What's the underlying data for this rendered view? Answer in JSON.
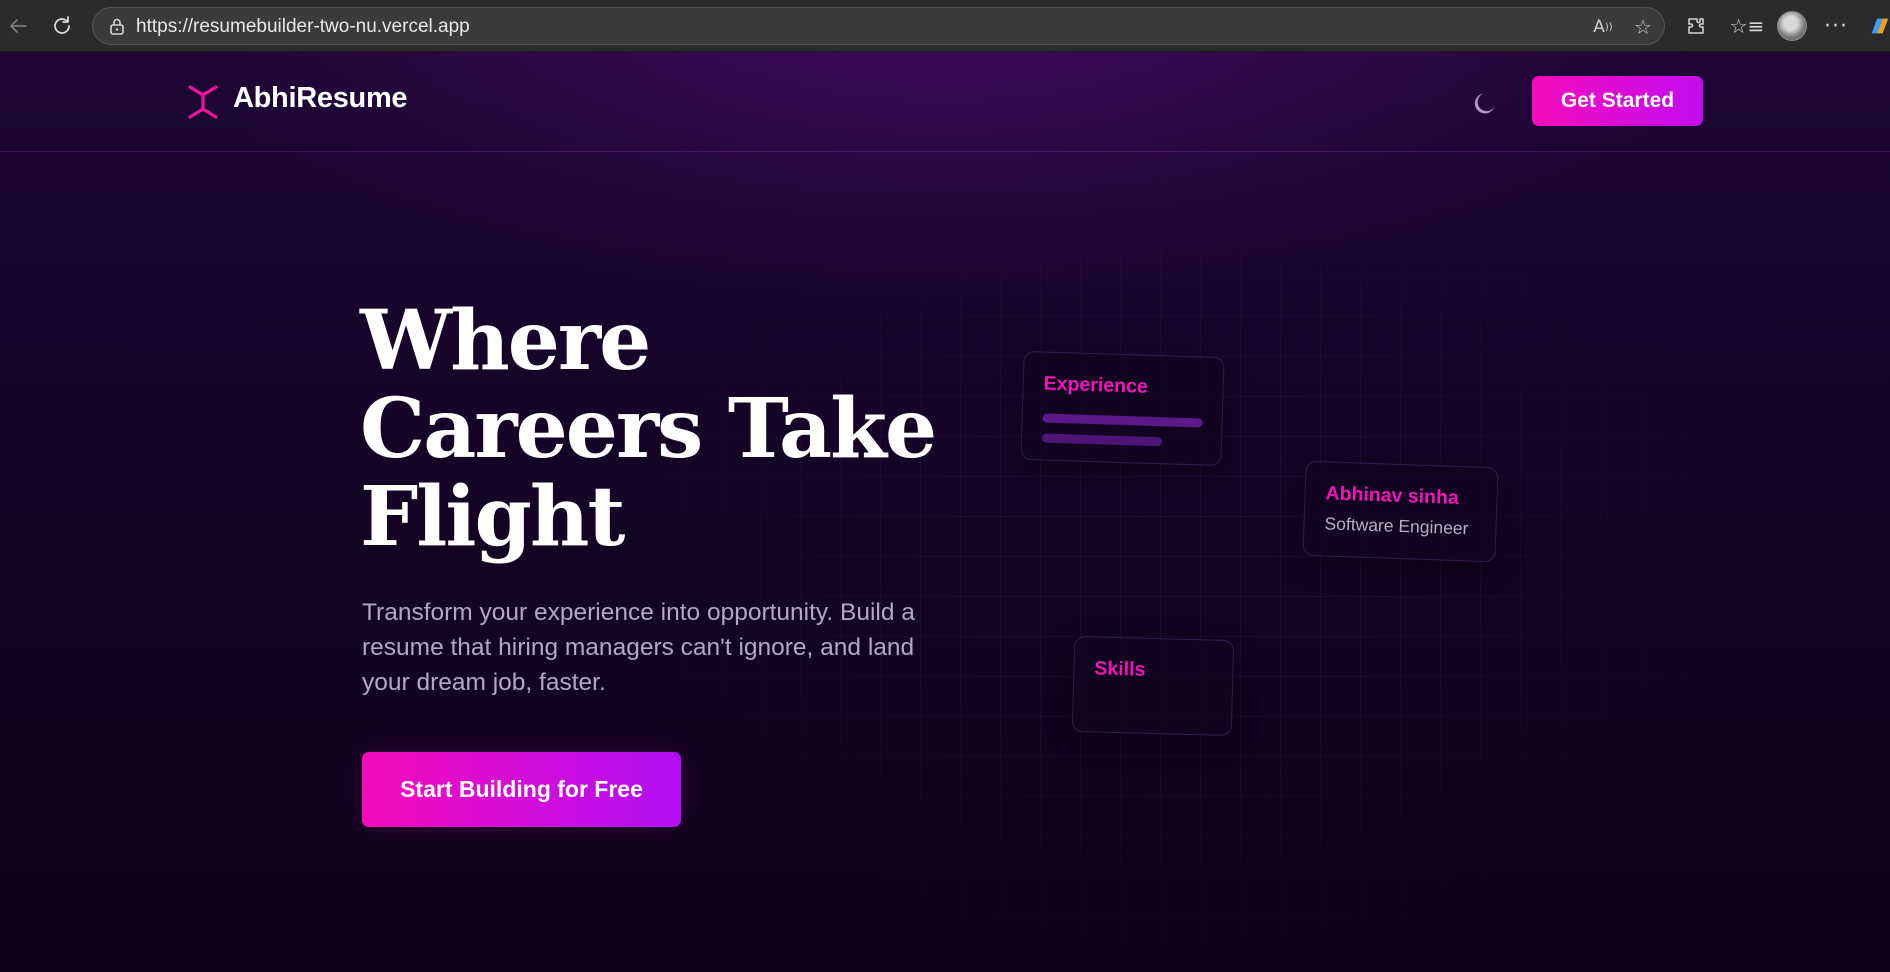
{
  "browser": {
    "url": "https://resumebuilder-two-nu.vercel.app",
    "icons": [
      "back-arrow-icon",
      "reload-icon",
      "lock-icon",
      "read-aloud-icon",
      "favorite-star-icon",
      "extensions-icon",
      "favorites-icon",
      "profile-avatar",
      "more-options-icon",
      "copilot-icon"
    ]
  },
  "header": {
    "brand": "AbhiResume",
    "cta_label": "Get Started",
    "theme_icon": "moon-icon"
  },
  "hero": {
    "title_lines": [
      "Where",
      "Careers Take",
      "Flight"
    ],
    "subtitle": "Transform your experience into opportunity. Build a resume that hiring managers can't ignore, and land your dream job, faster.",
    "cta_label": "Start Building for Free"
  },
  "cards": {
    "experience": {
      "heading": "Experience"
    },
    "profile": {
      "name": "Abhinav sinha",
      "role": "Software Engineer"
    },
    "skills": {
      "heading": "Skills"
    }
  },
  "colors": {
    "accent": "#f50cba",
    "accent_secondary": "#b10ef5",
    "background": "#150427",
    "card_heading": "#ee16b8"
  }
}
